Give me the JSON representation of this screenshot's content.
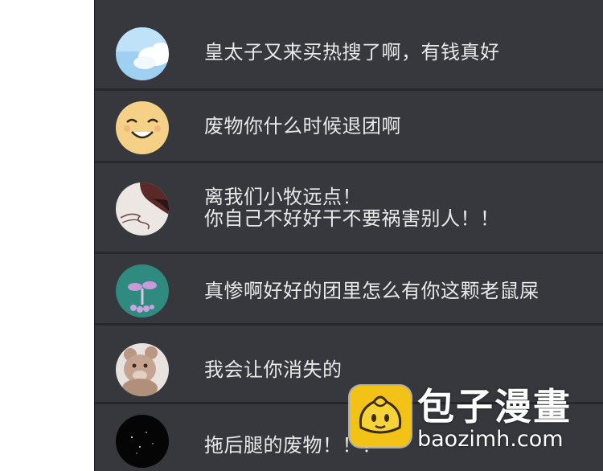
{
  "comments": [
    {
      "avatar_icon": "sky-cloud-avatar-icon",
      "text": "皇太子又来买热搜了啊，有钱真好"
    },
    {
      "avatar_icon": "smiley-face-avatar-icon",
      "text": "废物你什么时候退团啊"
    },
    {
      "avatar_icon": "abstract-drawing-avatar-icon",
      "line1": "离我们小牧远点！",
      "line2": "你自己不好好干不要祸害别人！！"
    },
    {
      "avatar_icon": "sprout-plant-avatar-icon",
      "text": "真惨啊好好的团里怎么有你这颗老鼠屎"
    },
    {
      "avatar_icon": "teddy-bear-avatar-icon",
      "text": "我会让你消失的"
    },
    {
      "avatar_icon": "starry-night-avatar-icon",
      "text": "拖后腿的废物！！！"
    }
  ],
  "watermark": {
    "title": "包子漫畫",
    "url": "baozimh.com"
  },
  "colors": {
    "panel": "#26282c",
    "row": "#36383d",
    "text": "#e9e9e9",
    "logo": "#f2c316"
  }
}
